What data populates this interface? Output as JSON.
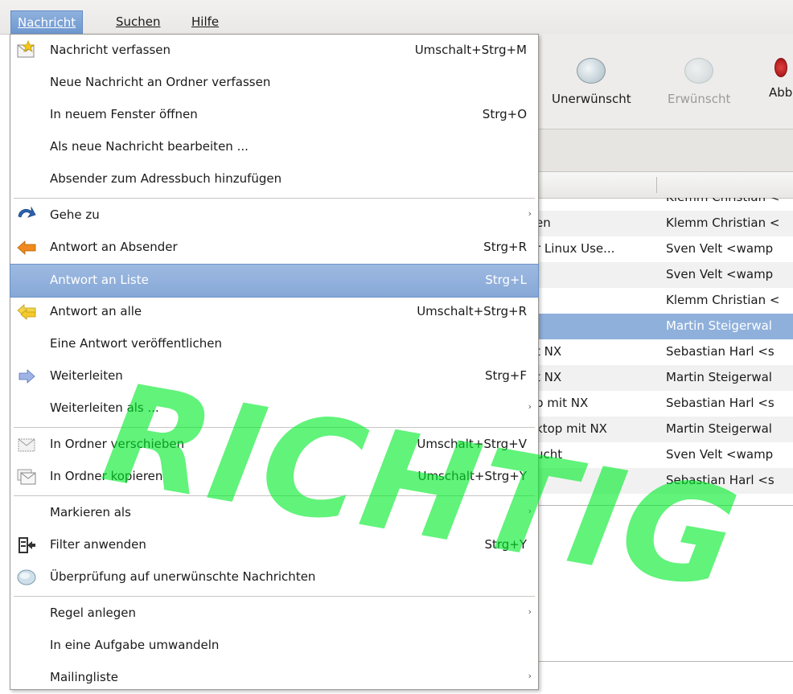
{
  "menubar": {
    "items": [
      {
        "label": "Nachricht"
      },
      {
        "label": "Suchen"
      },
      {
        "label": "Hilfe"
      }
    ]
  },
  "toolbar": {
    "unwanted_label": "Unerwünscht",
    "wanted_label": "Erwünscht",
    "cut_label": "Abb"
  },
  "message_list": {
    "rows": [
      {
        "subject": "",
        "sender": "Klemm Christian <"
      },
      {
        "subject": "en",
        "sender": "Klemm Christian <"
      },
      {
        "subject": "r Linux Use...",
        "sender": "Sven Velt <wamp"
      },
      {
        "subject": "",
        "sender": "Sven Velt <wamp"
      },
      {
        "subject": "",
        "sender": "Klemm Christian <"
      },
      {
        "subject": "",
        "sender": "Martin Steigerwal"
      },
      {
        "subject": "t NX",
        "sender": "Sebastian Harl <s"
      },
      {
        "subject": "t NX",
        "sender": "Martin Steigerwal"
      },
      {
        "subject": "p mit NX",
        "sender": "Sebastian Harl <s"
      },
      {
        "subject": "ktop mit NX",
        "sender": "Martin Steigerwal"
      },
      {
        "subject": "ucht",
        "sender": "Sven Velt <wamp"
      },
      {
        "subject": "",
        "sender": "Sebastian Harl <s"
      }
    ]
  },
  "menu": {
    "items": [
      {
        "label": "Nachricht verfassen",
        "shortcut": "Umschalt+Strg+M",
        "icon": "compose-icon"
      },
      {
        "label": "Neue Nachricht an Ordner verfassen",
        "shortcut": ""
      },
      {
        "label": "In neuem Fenster öffnen",
        "shortcut": "Strg+O"
      },
      {
        "label": "Als neue Nachricht bearbeiten ...",
        "shortcut": ""
      },
      {
        "label": "Absender zum Adressbuch hinzufügen",
        "shortcut": ""
      },
      {
        "label": "Gehe zu",
        "shortcut": "",
        "icon": "goto-arrow-icon",
        "submenu": true
      },
      {
        "label": "Antwort an Absender",
        "shortcut": "Strg+R",
        "icon": "reply-icon"
      },
      {
        "label": "Antwort an Liste",
        "shortcut": "Strg+L",
        "highlighted": true
      },
      {
        "label": "Antwort an alle",
        "shortcut": "Umschalt+Strg+R",
        "icon": "reply-all-icon"
      },
      {
        "label": "Eine Antwort veröffentlichen",
        "shortcut": ""
      },
      {
        "label": "Weiterleiten",
        "shortcut": "Strg+F",
        "icon": "forward-icon"
      },
      {
        "label": "Weiterleiten als ...",
        "shortcut": "",
        "submenu": true
      },
      {
        "label": "In Ordner verschieben",
        "shortcut": "Umschalt+Strg+V",
        "icon": "move-folder-icon"
      },
      {
        "label": "In Ordner kopieren",
        "shortcut": "Umschalt+Strg+Y",
        "icon": "copy-folder-icon"
      },
      {
        "label": "Markieren als",
        "shortcut": "",
        "submenu": true
      },
      {
        "label": "Filter anwenden",
        "shortcut": "Strg+Y",
        "icon": "filter-icon"
      },
      {
        "label": "Überprüfung auf unerwünschte Nachrichten",
        "shortcut": "",
        "icon": "junk-check-icon"
      },
      {
        "label": "Regel anlegen",
        "shortcut": "",
        "submenu": true
      },
      {
        "label": "In eine Aufgabe umwandeln",
        "shortcut": ""
      },
      {
        "label": "Mailingliste",
        "shortcut": "",
        "submenu": true
      }
    ]
  },
  "watermark": "RICHTIG",
  "colors": {
    "highlight": "#8aa9d6",
    "watermark": "#00e628",
    "selected_row": "#8fb0db"
  }
}
